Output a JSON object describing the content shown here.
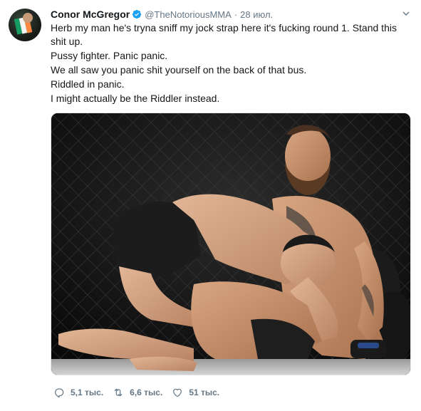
{
  "tweet": {
    "author_name": "Conor McGregor",
    "author_handle": "@TheNotoriousMMA",
    "separator": "·",
    "date": "28 июл.",
    "lines": [
      "Herb my man he's tryna sniff my jock strap here it's fucking round 1. Stand this shit up.",
      "Pussy fighter. Panic panic.",
      "We all saw you panic shit yourself on the back of that bus.",
      "Riddled in panic.",
      "I might actually be the Riddler instead."
    ],
    "verified_icon": "verified-badge-icon",
    "media_description": "photo",
    "accent_color": "#1da1f2",
    "muted_color": "#657786"
  },
  "actions": {
    "reply_count": "5,1 тыс.",
    "retweet_count": "6,6 тыс.",
    "like_count": "51 тыс.",
    "reply_icon": "reply-icon",
    "retweet_icon": "retweet-icon",
    "like_icon": "heart-icon"
  }
}
